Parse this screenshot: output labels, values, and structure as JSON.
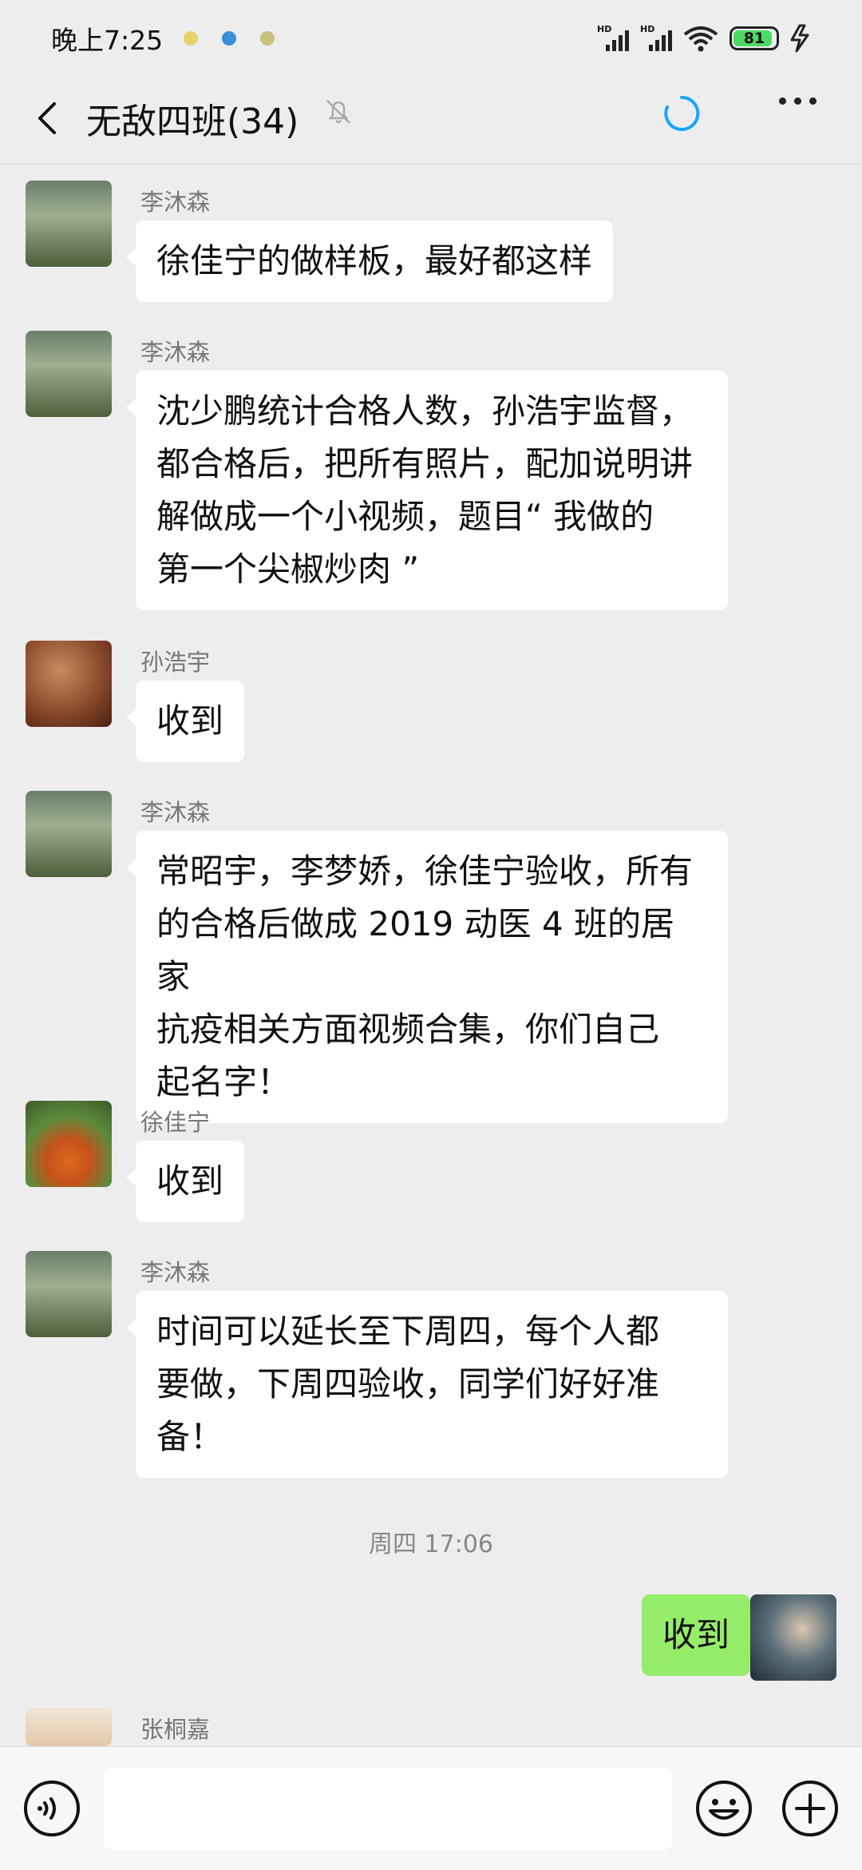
{
  "status_bar": {
    "time": "晚上7:25",
    "signal_labels": [
      "HD",
      "HD"
    ],
    "battery": "81",
    "notification_icons": [
      "app-icon-1",
      "app-icon-2",
      "app-icon-3"
    ]
  },
  "header": {
    "title": "无敌四班(34)",
    "back_icon": "chevron-left-icon",
    "mute_icon": "bell-off-icon",
    "loading_icon": "spinner-icon",
    "more_icon": "more-dots-icon"
  },
  "messages": [
    {
      "sender": "李沐森",
      "text": [
        "徐佳宁的做样板，最好都这样"
      ]
    },
    {
      "sender": "李沐森",
      "text": [
        "沈少鹏统计合格人数，孙浩宇监督，",
        "都合格后，把所有照片，配加说明讲",
        "解做成一个小视频，题目“ 我做的",
        "第一个尖椒炒肉 ”"
      ]
    },
    {
      "sender": "孙浩宇",
      "text": [
        "收到"
      ]
    },
    {
      "sender": "李沐森",
      "text": [
        "常昭宇，李梦娇，徐佳宁验收，所有",
        "的合格后做成 2019 动医 4 班的居家",
        "抗疫相关方面视频合集，你们自己",
        "起名字！"
      ]
    },
    {
      "sender": "徐佳宁",
      "text": [
        "收到"
      ]
    },
    {
      "sender": "李沐森",
      "text": [
        "时间可以延长至下周四，每个人都",
        "要做，下周四验收，同学们好好准",
        "备！"
      ]
    }
  ],
  "time_separator": "周四 17:06",
  "my_message": "收到",
  "last_sender": "张桐嘉",
  "input": {
    "placeholder": ""
  },
  "colors": {
    "background": "#ededed",
    "my_bubble": "#95ec69",
    "their_bubble": "#ffffff",
    "battery_fill": "#4cd964",
    "loading": "#1aa3ff"
  }
}
